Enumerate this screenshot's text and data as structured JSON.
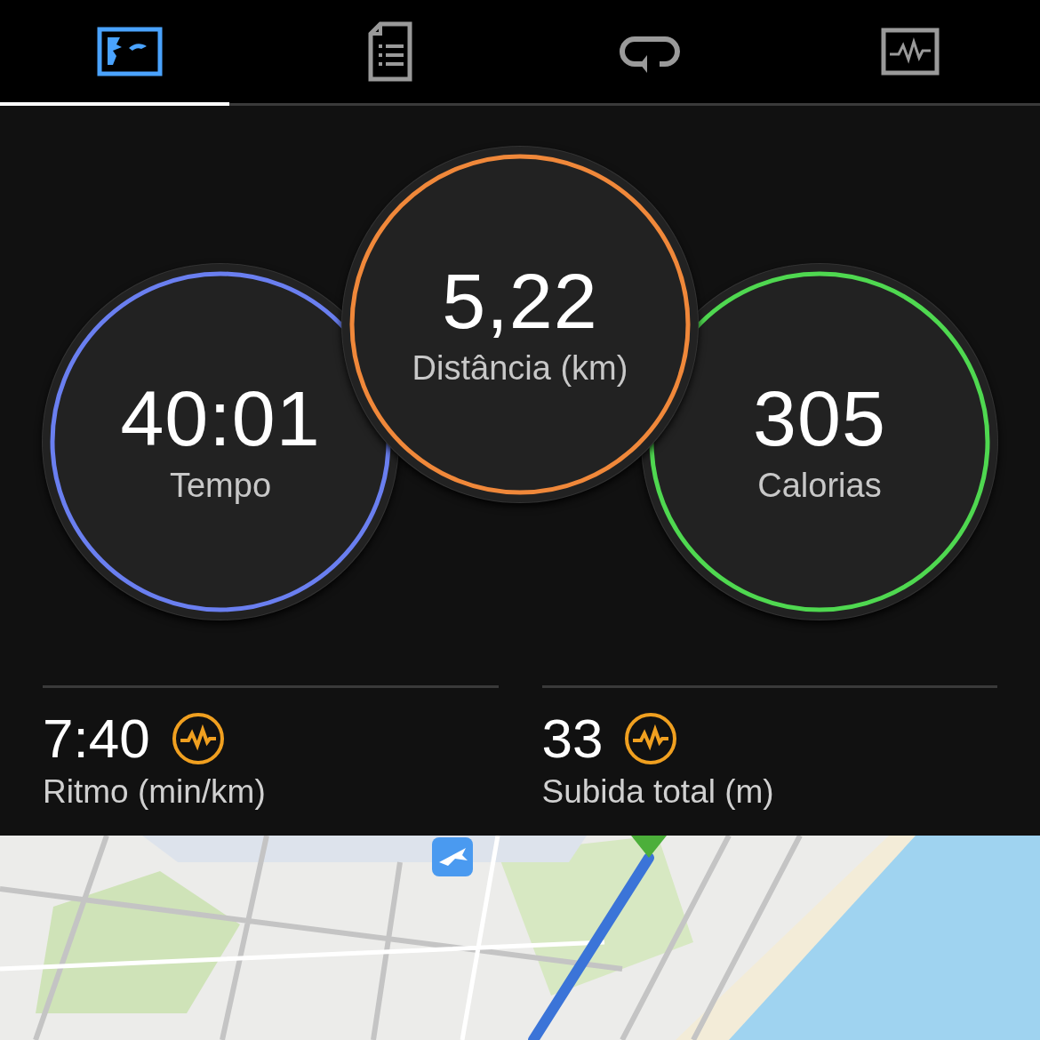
{
  "tabs": [
    {
      "kind": "map",
      "selected": true
    },
    {
      "kind": "details",
      "selected": false
    },
    {
      "kind": "laps",
      "selected": false
    },
    {
      "kind": "chart",
      "selected": false
    }
  ],
  "rings": [
    {
      "value": "40:01",
      "label": "Tempo",
      "color": "#6a7ff0"
    },
    {
      "value": "5,22",
      "label": "Distância (km)",
      "color": "#f0883a"
    },
    {
      "value": "305",
      "label": "Calorias",
      "color": "#4fd850"
    }
  ],
  "stats": [
    {
      "value": "7:40",
      "label": "Ritmo (min/km)"
    },
    {
      "value": "33",
      "label": "Subida total (m)"
    }
  ]
}
